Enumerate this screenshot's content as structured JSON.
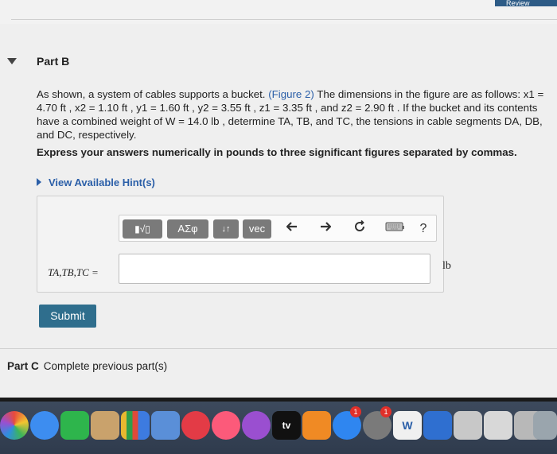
{
  "header": {
    "review_label": "Review"
  },
  "part_b": {
    "title": "Part B",
    "question_pre": "As shown, a system of cables supports a bucket. ",
    "figure_link": "(Figure 2)",
    "question_post": " The dimensions in the figure are as follows: x1 = 4.70 ft , x2 = 1.10 ft , y1 = 1.60 ft , y2 = 3.55 ft , z1 = 3.35 ft , and z2 = 2.90 ft . If the bucket and its contents have a combined weight of W = 14.0 lb , determine TA, TB, and TC, the tensions in cable segments DA, DB, and DC, respectively.",
    "instruction": "Express your answers numerically in pounds to three significant figures separated by commas.",
    "hint_label": "View Available Hint(s)"
  },
  "toolbar": {
    "templates_label": "▮√▯",
    "greek_label": "ΑΣφ",
    "arrows_label": "↓↑",
    "vec_label": "vec",
    "help_label": "?"
  },
  "answer": {
    "variable_label": "TA,TB,TC =",
    "value": "",
    "unit": "lb"
  },
  "submit_label": "Submit",
  "part_c": {
    "label": "Part C",
    "status": "Complete previous part(s)"
  },
  "dock": {
    "tv_label": "tv",
    "badges": [
      "1",
      "1"
    ],
    "word_label": "W"
  }
}
